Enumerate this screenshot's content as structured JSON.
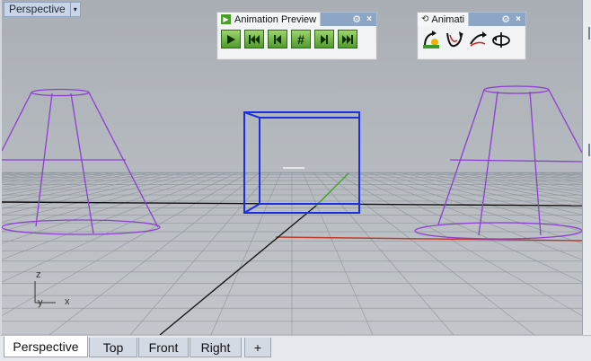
{
  "viewport": {
    "label": "Perspective",
    "label_arrow": "▾"
  },
  "animation_panel": {
    "title": "Animation Preview",
    "play_icon": "▶",
    "gear": "⚙",
    "close": "×",
    "buttons": [
      "play-icon",
      "first-frame-icon",
      "previous-frame-icon",
      "frame-number-icon",
      "next-frame-icon",
      "last-frame-icon"
    ],
    "frame_glyph": "#"
  },
  "anim_panel2": {
    "title": "Animati",
    "gear": "⚙",
    "close": "×",
    "buttons": [
      "set-camera-path-icon",
      "camera-path-icon",
      "turntable-icon",
      "rotate-view-icon"
    ]
  },
  "axes": {
    "z": "z",
    "y": "y",
    "x": "x"
  },
  "tabs": [
    "Perspective",
    "Top",
    "Front",
    "Right"
  ],
  "add_tab": "+",
  "colors": {
    "accent": "#8da6c6",
    "wire": "#8c3fcf",
    "box": "#1a2fe0",
    "x_axis": "#c23a2a",
    "y_axis": "#3f9a25"
  }
}
